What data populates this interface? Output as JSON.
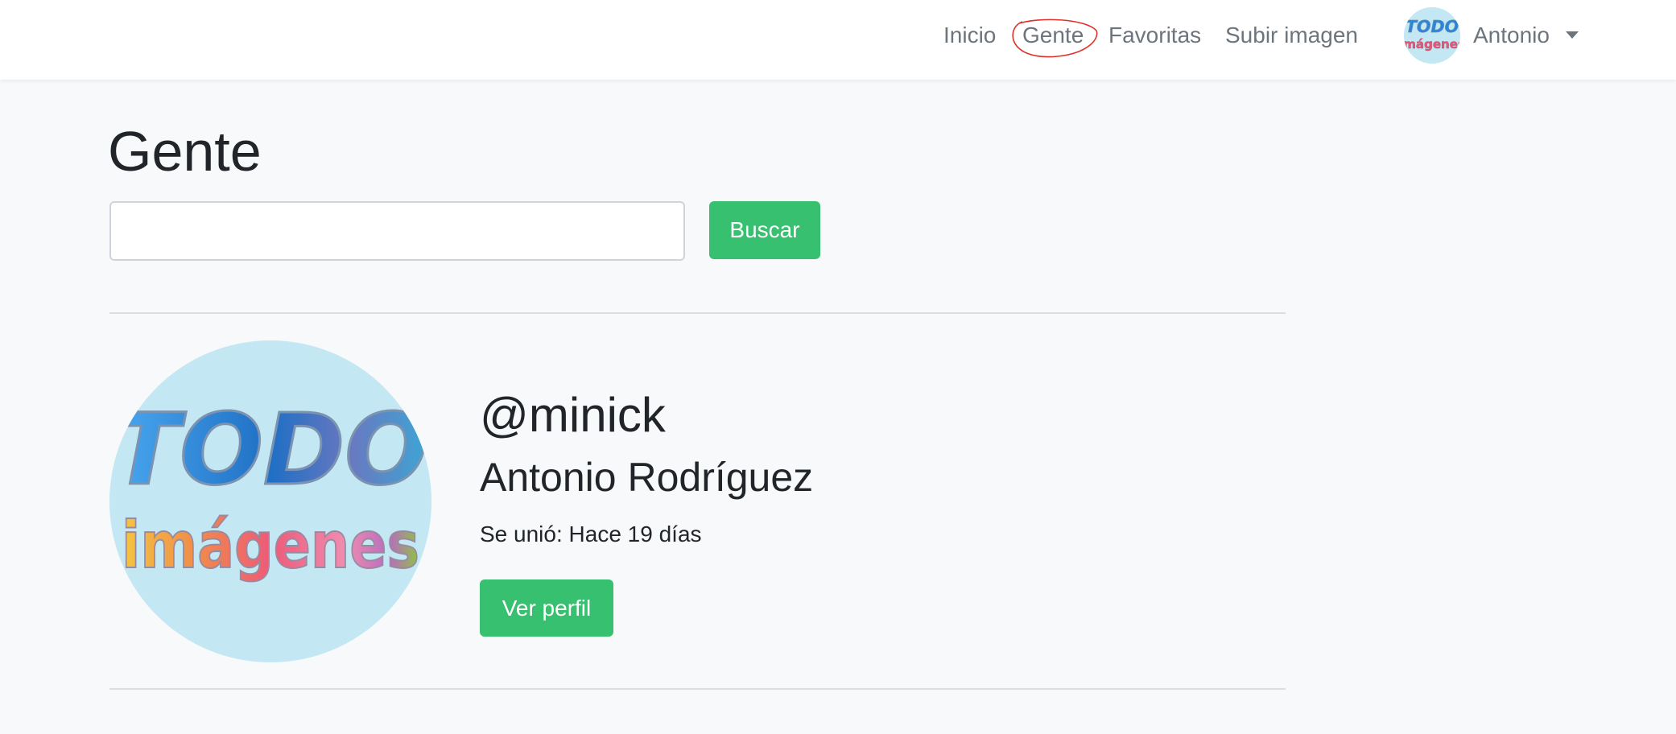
{
  "navbar": {
    "links": [
      {
        "label": "Inicio"
      },
      {
        "label": "Gente",
        "active": true
      },
      {
        "label": "Favoritas"
      },
      {
        "label": "Subir imagen"
      }
    ],
    "user": {
      "name": "Antonio",
      "avatar_icon": "todo-imagenes-logo"
    },
    "active_marker_color": "#e0302a"
  },
  "main": {
    "title": "Gente",
    "search": {
      "value": "",
      "placeholder": "",
      "button_label": "Buscar"
    },
    "people": [
      {
        "username": "@minick",
        "full_name": "Antonio Rodríguez",
        "joined_label": "Se unió:",
        "joined_value": "Hace 19 días",
        "button_label": "Ver perfil",
        "avatar": {
          "logo_top": "TODO",
          "logo_bottom": "imágenes",
          "icon": "todo-imagenes-logo"
        }
      }
    ]
  },
  "colors": {
    "accent": "#36c06f",
    "background": "#f8f9fa",
    "navbar": "#ffffff",
    "avatar_bg": "#c4e8f3"
  }
}
